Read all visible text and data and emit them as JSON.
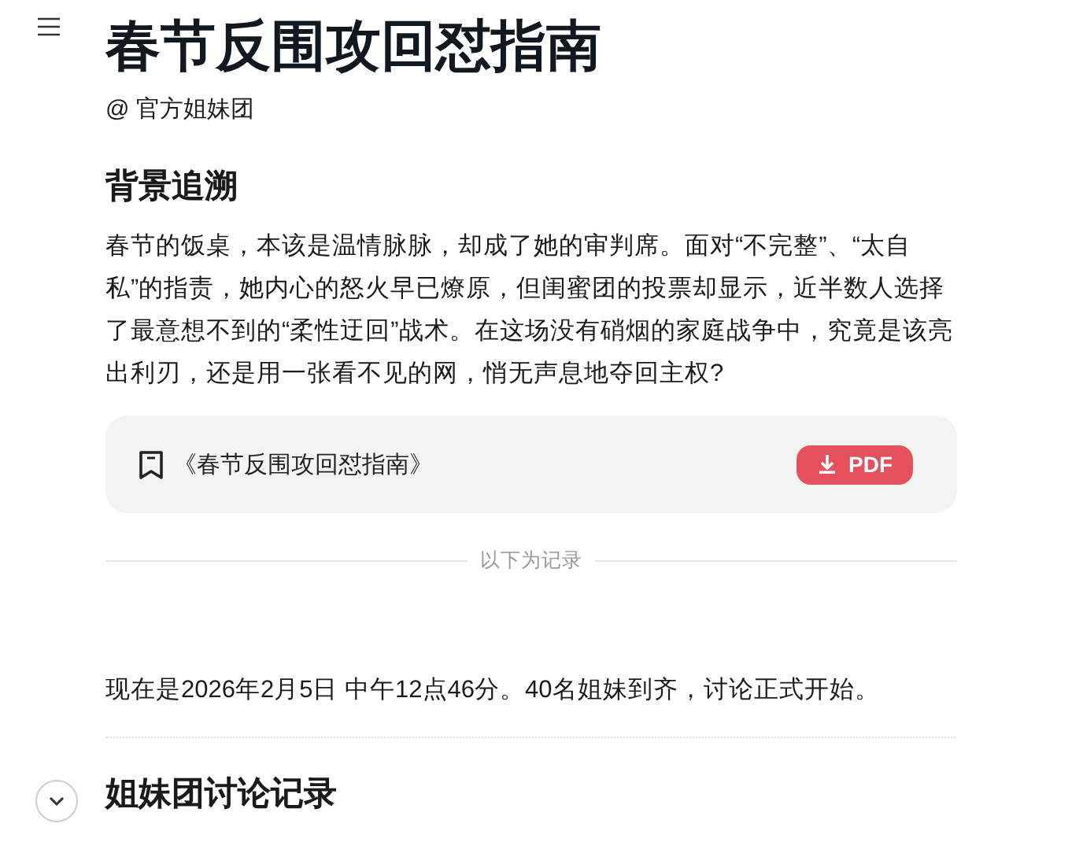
{
  "title": "春节反围攻回怼指南",
  "author": "@ 官方姐妹团",
  "sections": [
    {
      "heading": "背景追溯",
      "paragraph": "春节的饭桌，本该是温情脉脉，却成了她的审判席。面对“不完整”、“太自私”的指责，她内心的怒火早已燎原，但闺蜜团的投票却显示，近半数人选择了最意想不到的“柔性迂回”战术。在这场没有硝烟的家庭战争中，究竟是该亮出利刃，还是用一张看不见的网，悄无声息地夺回主权?"
    }
  ],
  "document_card": {
    "name": "《春节反围攻回怼指南》",
    "button": "PDF"
  },
  "divider_label": "以下为记录",
  "intro": "现在是2026年2月5日 中午12点46分。40名姐妹到齐，讨论正式开始。",
  "record_heading": "姐妹团讨论记录"
}
